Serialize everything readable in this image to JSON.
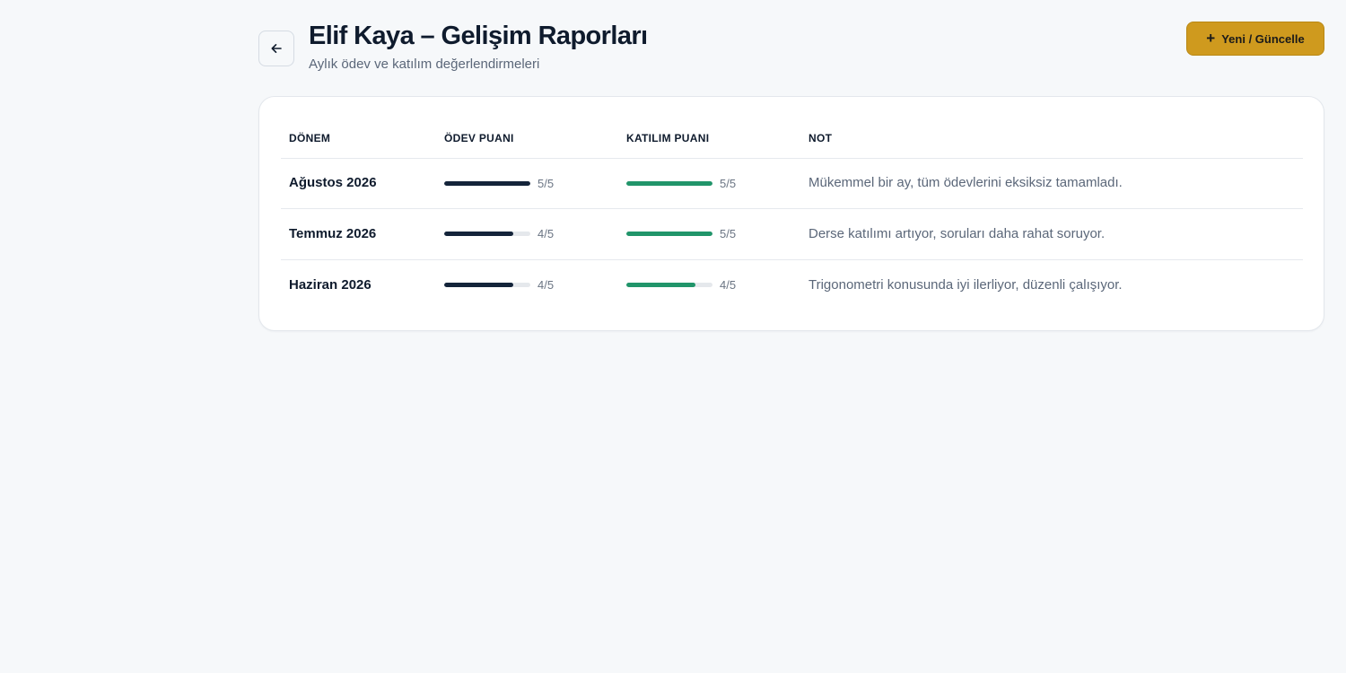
{
  "header": {
    "title": "Elif Kaya – Gelişim Raporları",
    "subtitle": "Aylık ödev ve katılım değerlendirmeleri",
    "new_button_label": "Yeni / Güncelle"
  },
  "colors": {
    "accent": "#cf9a1e",
    "homework_bar": "#14243a",
    "participation_bar": "#21956a"
  },
  "table": {
    "columns": [
      "DÖNEM",
      "ÖDEV PUANI",
      "KATILIM PUANI",
      "NOT"
    ],
    "max_score": 5,
    "rows": [
      {
        "period": "Ağustos 2026",
        "homework": 5,
        "homework_text": "5/5",
        "participation": 5,
        "participation_text": "5/5",
        "note": "Mükemmel bir ay, tüm ödevlerini eksiksiz tamamladı."
      },
      {
        "period": "Temmuz 2026",
        "homework": 4,
        "homework_text": "4/5",
        "participation": 5,
        "participation_text": "5/5",
        "note": "Derse katılımı artıyor, soruları daha rahat soruyor."
      },
      {
        "period": "Haziran 2026",
        "homework": 4,
        "homework_text": "4/5",
        "participation": 4,
        "participation_text": "4/5",
        "note": "Trigonometri konusunda iyi ilerliyor, düzenli çalışıyor."
      }
    ]
  }
}
